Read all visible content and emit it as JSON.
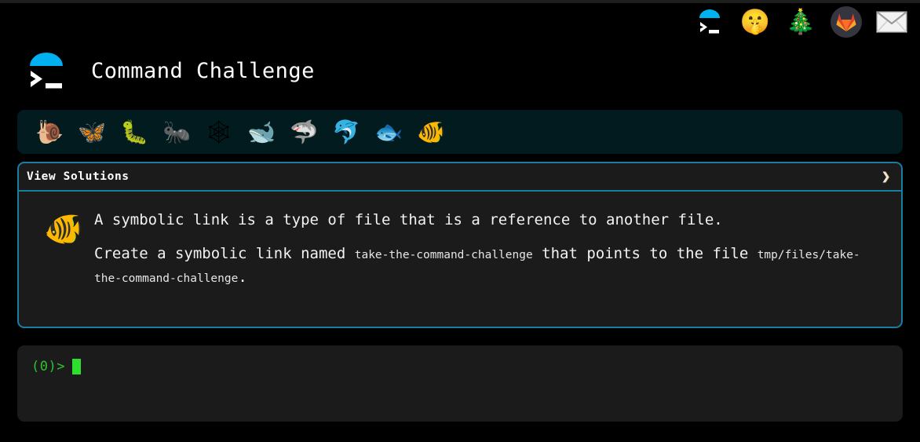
{
  "site": {
    "title": "Command Challenge",
    "logo_icon": "terminal-prompt-icon"
  },
  "topnav": {
    "items": [
      {
        "name": "terminal-logo-icon",
        "glyph": "",
        "label": "Command Challenge Home"
      },
      {
        "name": "shushing-face-icon",
        "glyph": "🤫",
        "label": "Secret"
      },
      {
        "name": "christmas-tree-icon",
        "glyph": "🎄",
        "label": "Holiday Challenges"
      },
      {
        "name": "gitlab-icon",
        "glyph": "",
        "label": "GitLab"
      },
      {
        "name": "envelope-icon",
        "glyph": "✉",
        "label": "Contact"
      }
    ]
  },
  "progress": {
    "items": [
      {
        "name": "snail-icon",
        "glyph": "🐌",
        "label": "Snail"
      },
      {
        "name": "butterfly-icon",
        "glyph": "🦋",
        "label": "Butterfly"
      },
      {
        "name": "caterpillar-icon",
        "glyph": "🐛",
        "label": "Caterpillar"
      },
      {
        "name": "ant-icon",
        "glyph": "🐜",
        "label": "Ant"
      },
      {
        "name": "spider-web-icon",
        "glyph": "🕸",
        "label": "Spider Web"
      },
      {
        "name": "whale-icon",
        "glyph": "🐋",
        "label": "Whale"
      },
      {
        "name": "shark-icon",
        "glyph": "🦈",
        "label": "Shark"
      },
      {
        "name": "dolphin-icon",
        "glyph": "🐬",
        "label": "Dolphin"
      },
      {
        "name": "fish-icon",
        "glyph": "🐟",
        "label": "Fish"
      },
      {
        "name": "tropical-fish-icon",
        "glyph": "🐠",
        "label": "Tropical Fish"
      }
    ]
  },
  "panel": {
    "header_label": "View Solutions",
    "chevron": "❯",
    "challenge_emoji": "🐠",
    "line1": "A symbolic link is a type of file that is a reference to another file.",
    "line2_part1": "Create a symbolic link named ",
    "line2_code1": "take-the-command-challenge",
    "line2_part2": " that points to the file ",
    "line2_code2": "tmp/files/take-the-command-challenge",
    "line2_part3": "."
  },
  "terminal": {
    "prompt": "(0)>",
    "value": "",
    "placeholder": ""
  },
  "colors": {
    "page_background": "#000000",
    "panel_background": "#1b1b1b",
    "panel_border": "#1a7f9e",
    "iconbar_background": "#021b1f",
    "prompt_green": "#2fc22f",
    "cursor_green": "#2ee02e",
    "logo_blue": "#00b0f0"
  }
}
